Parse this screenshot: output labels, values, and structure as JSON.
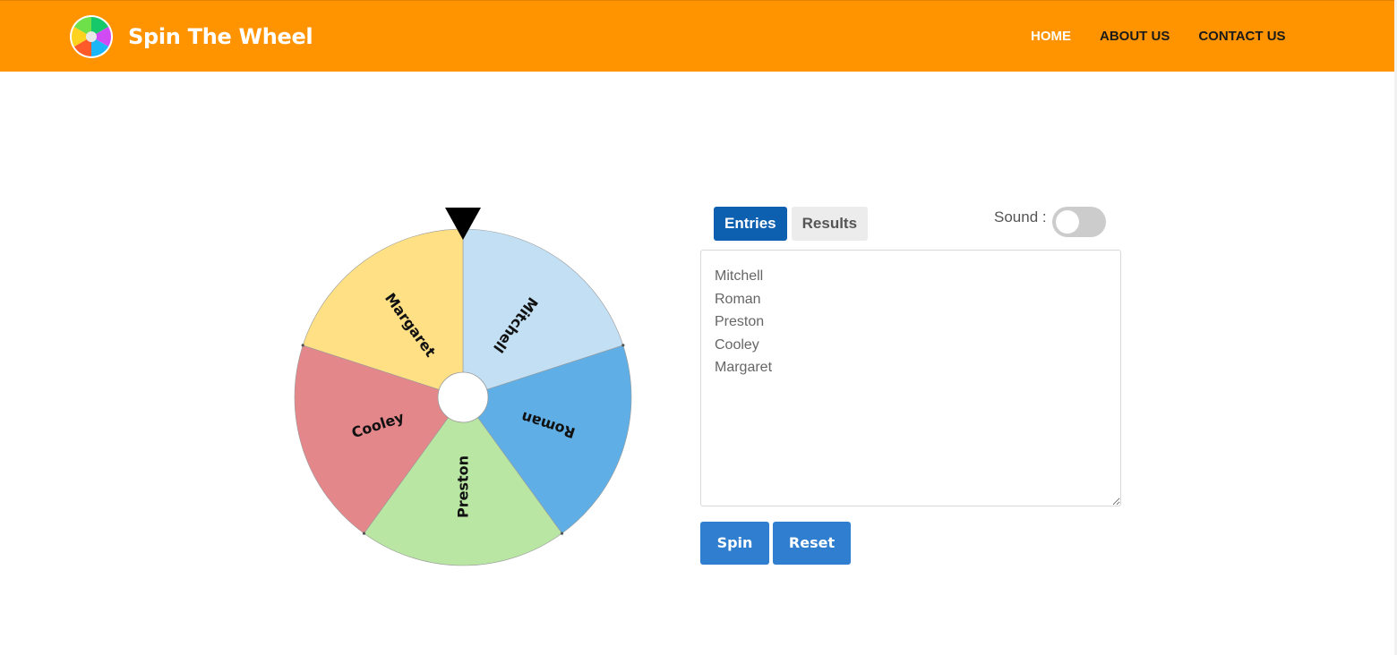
{
  "brand": {
    "title": "Spin The Wheel",
    "logo_icon": "color-wheel-logo-icon"
  },
  "colors": {
    "header_bg": "#ff9400",
    "tab_active": "#0d5fb0",
    "button": "#2f7ecf"
  },
  "nav": {
    "items": [
      {
        "label": "HOME",
        "active": true
      },
      {
        "label": "ABOUT US",
        "active": false
      },
      {
        "label": "CONTACT US",
        "active": false
      }
    ]
  },
  "wheel": {
    "pointer_icon": "down-triangle-pointer-icon",
    "segments": [
      {
        "label": "Mitchell",
        "color": "#c3dff3"
      },
      {
        "label": "Roman",
        "color": "#5fafe6"
      },
      {
        "label": "Preston",
        "color": "#b9e7a3"
      },
      {
        "label": "Cooley",
        "color": "#e4878b"
      },
      {
        "label": "Margaret",
        "color": "#ffe085"
      }
    ]
  },
  "panel": {
    "tabs": [
      {
        "label": "Entries",
        "active": true
      },
      {
        "label": "Results",
        "active": false
      }
    ],
    "sound_label": "Sound :",
    "sound_on": false,
    "entries_text": "Mitchell\nRoman\nPreston\nCooley\nMargaret",
    "spin_label": "Spin",
    "reset_label": "Reset"
  }
}
